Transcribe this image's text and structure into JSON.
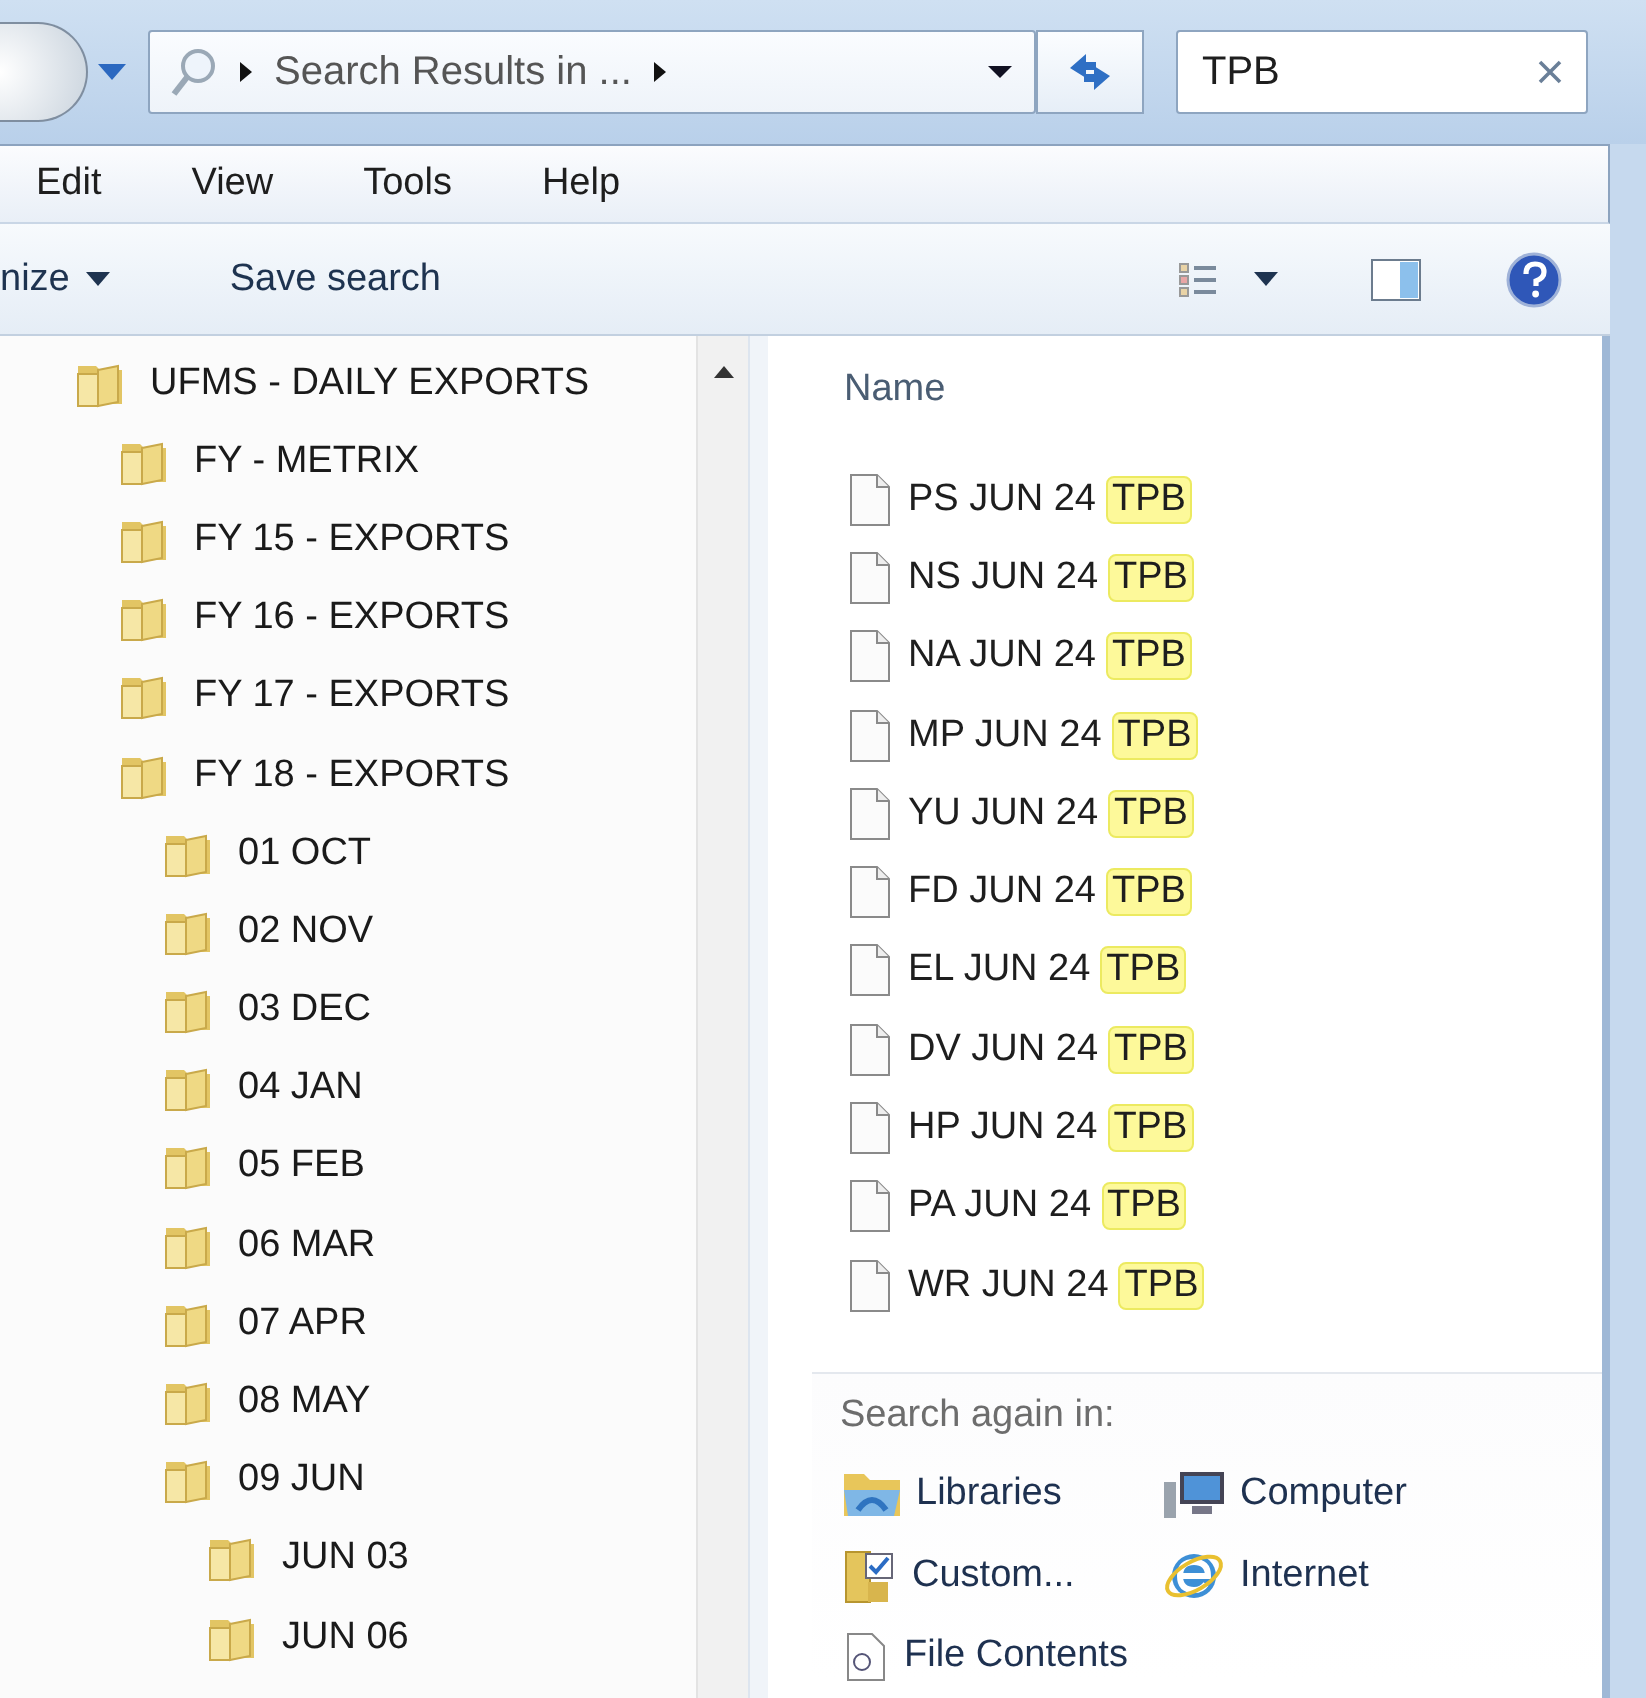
{
  "address_bar": {
    "text": "Search Results in ..."
  },
  "search_box": {
    "value": "TPB"
  },
  "menu": [
    "Edit",
    "View",
    "Tools",
    "Help"
  ],
  "toolbar": {
    "organize": "nize",
    "save_search": "Save search"
  },
  "nav_tree": [
    {
      "label": "UFMS - DAILY EXPORTS",
      "children": [
        {
          "label": "FY - METRIX"
        },
        {
          "label": "FY 15 - EXPORTS"
        },
        {
          "label": "FY 16 - EXPORTS"
        },
        {
          "label": "FY 17 - EXPORTS"
        },
        {
          "label": "FY 18 - EXPORTS",
          "children": [
            {
              "label": "01 OCT"
            },
            {
              "label": "02 NOV"
            },
            {
              "label": "03 DEC"
            },
            {
              "label": "04 JAN"
            },
            {
              "label": "05 FEB"
            },
            {
              "label": "06 MAR"
            },
            {
              "label": "07 APR"
            },
            {
              "label": "08 MAY"
            },
            {
              "label": "09 JUN",
              "children": [
                {
                  "label": "JUN 03"
                },
                {
                  "label": "JUN 06"
                }
              ]
            }
          ]
        }
      ]
    }
  ],
  "results": {
    "column": "Name",
    "files": [
      {
        "name": "PS JUN 24",
        "match": "TPB"
      },
      {
        "name": "NS JUN 24",
        "match": "TPB"
      },
      {
        "name": "NA JUN 24",
        "match": "TPB"
      },
      {
        "name": "MP JUN 24",
        "match": "TPB"
      },
      {
        "name": "YU JUN 24",
        "match": "TPB"
      },
      {
        "name": "FD JUN 24",
        "match": "TPB"
      },
      {
        "name": "EL JUN 24",
        "match": "TPB"
      },
      {
        "name": "DV JUN 24",
        "match": "TPB"
      },
      {
        "name": "HP JUN 24",
        "match": "TPB"
      },
      {
        "name": "PA JUN 24",
        "match": "TPB"
      },
      {
        "name": "WR JUN 24",
        "match": "TPB"
      }
    ]
  },
  "search_again": {
    "title": "Search again in:",
    "locations": [
      {
        "label": "Libraries",
        "kind": "libraries"
      },
      {
        "label": "Computer",
        "kind": "computer"
      },
      {
        "label": "Custom...",
        "kind": "custom"
      },
      {
        "label": "Internet",
        "kind": "internet"
      },
      {
        "label": "File Contents",
        "kind": "contents"
      }
    ]
  }
}
